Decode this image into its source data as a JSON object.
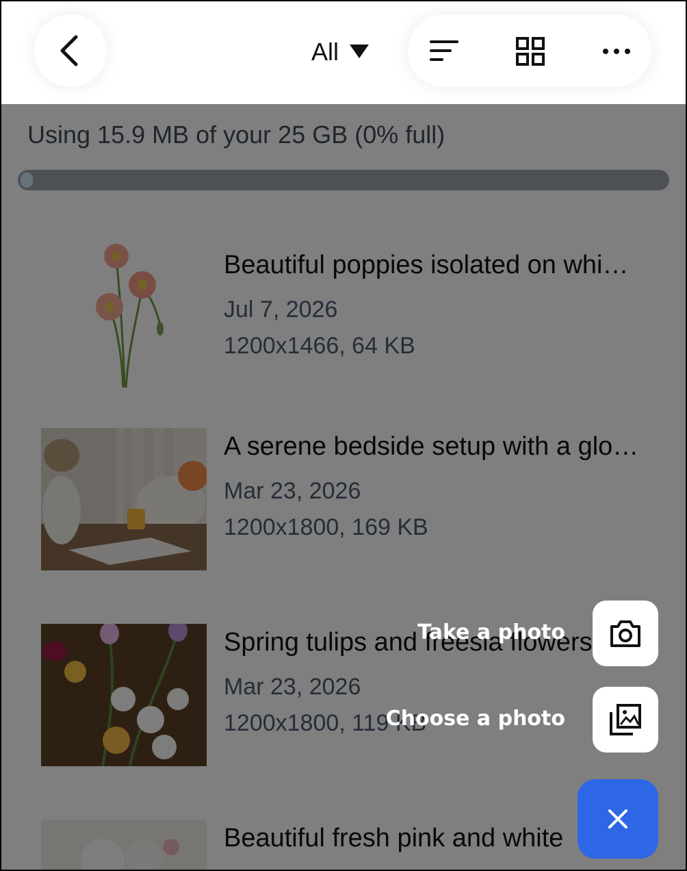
{
  "header": {
    "filter_label": "All",
    "icons": [
      "back-arrow-icon",
      "caret-down-icon",
      "sort-icon",
      "grid-view-icon",
      "more-icon"
    ]
  },
  "storage": {
    "text": "Using 15.9 MB of your 25 GB (0% full)",
    "used_fraction": 0.0
  },
  "files": [
    {
      "title": "Beautiful poppies isolated on whi…",
      "date": "Jul 7, 2026",
      "info": "1200x1466, 64 KB"
    },
    {
      "title": "A serene bedside setup with a glo…",
      "date": "Mar 23, 2026",
      "info": "1200x1800, 169 KB"
    },
    {
      "title": "Spring tulips and freesia flowers",
      "date": "Mar 23, 2026",
      "info": "1200x1800, 119 KB"
    },
    {
      "title": "Beautiful fresh pink and white",
      "date": "",
      "info": ""
    }
  ],
  "fab_menu": {
    "take_photo_label": "Take a photo",
    "choose_photo_label": "Choose a photo",
    "accent_color": "#2e67e6"
  }
}
